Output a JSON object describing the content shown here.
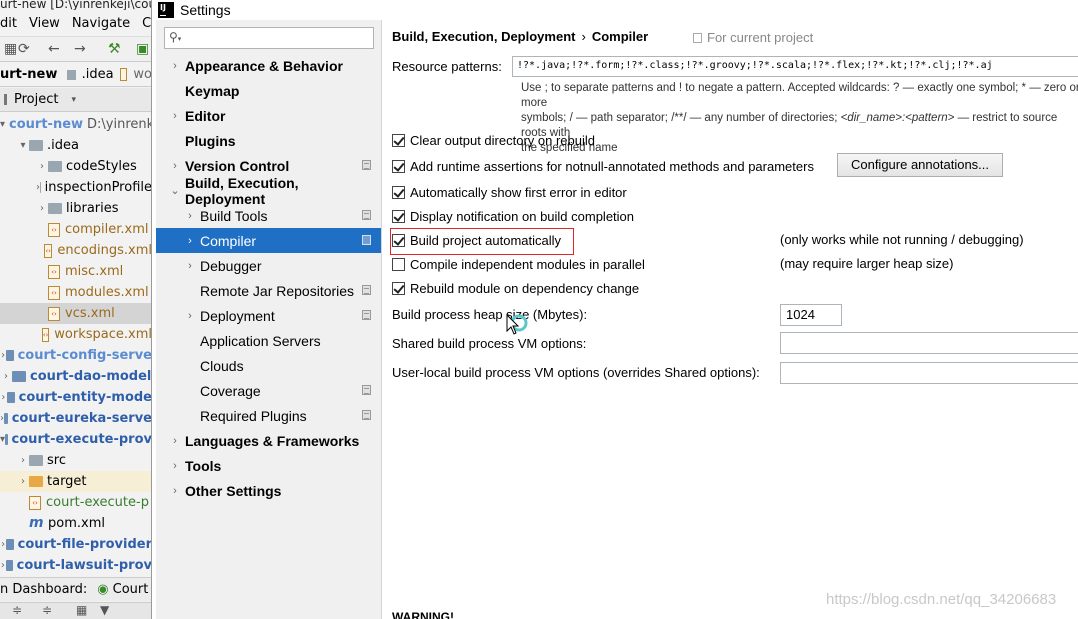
{
  "ide": {
    "title": "urt-new [D:\\yinrenkeji\\cou",
    "menu": [
      "dit",
      "View",
      "Navigate",
      "Co"
    ],
    "nav_bar": {
      "project": "urt-new",
      "folder": ".idea",
      "file": "wo"
    },
    "project_header": "Project",
    "tree": [
      {
        "label": "court-new",
        "extra": "D:\\yinrenke",
        "style": "lightblue",
        "kind": "folder-mod",
        "arrow": "▾",
        "indent": 0
      },
      {
        "label": ".idea",
        "style": "plain",
        "kind": "folder",
        "arrow": "▾",
        "indent": 1
      },
      {
        "label": "codeStyles",
        "style": "plain",
        "kind": "folder",
        "arrow": "›",
        "indent": 2
      },
      {
        "label": "inspectionProfile",
        "style": "plain",
        "kind": "folder",
        "arrow": "›",
        "indent": 2
      },
      {
        "label": "libraries",
        "style": "plain",
        "kind": "folder",
        "arrow": "›",
        "indent": 2
      },
      {
        "label": "compiler.xml",
        "style": "brown",
        "kind": "file",
        "arrow": "",
        "indent": 2
      },
      {
        "label": "encodings.xml",
        "style": "brown",
        "kind": "file",
        "arrow": "",
        "indent": 2
      },
      {
        "label": "misc.xml",
        "style": "brown",
        "kind": "file",
        "arrow": "",
        "indent": 2
      },
      {
        "label": "modules.xml",
        "style": "brown",
        "kind": "file",
        "arrow": "",
        "indent": 2
      },
      {
        "label": "vcs.xml",
        "style": "brown",
        "kind": "file",
        "arrow": "",
        "indent": 2,
        "selected": true
      },
      {
        "label": "workspace.xml",
        "style": "brown",
        "kind": "file",
        "arrow": "",
        "indent": 2
      },
      {
        "label": "court-config-serve",
        "style": "lightblue",
        "kind": "folder-mod",
        "arrow": "›",
        "indent": 0
      },
      {
        "label": "court-dao-model",
        "style": "blue",
        "kind": "folder-mod",
        "arrow": "›",
        "indent": 0
      },
      {
        "label": "court-entity-mode",
        "style": "blue",
        "kind": "folder-mod",
        "arrow": "›",
        "indent": 0
      },
      {
        "label": "court-eureka-serve",
        "style": "blue",
        "kind": "folder-mod",
        "arrow": "›",
        "indent": 0
      },
      {
        "label": "court-execute-prov",
        "style": "blue",
        "kind": "folder-mod",
        "arrow": "▾",
        "indent": 0
      },
      {
        "label": "src",
        "style": "plain",
        "kind": "folder",
        "arrow": "›",
        "indent": 1
      },
      {
        "label": "target",
        "style": "plain",
        "kind": "folder-orange",
        "arrow": "›",
        "indent": 1,
        "highlight": true
      },
      {
        "label": "court-execute-p",
        "style": "green",
        "kind": "file",
        "arrow": "",
        "indent": 1
      },
      {
        "label": "pom.xml",
        "style": "plain",
        "kind": "file-m",
        "arrow": "",
        "indent": 1
      },
      {
        "label": "court-file-provider",
        "style": "blue",
        "kind": "folder-mod",
        "arrow": "›",
        "indent": 0
      },
      {
        "label": "court-lawsuit-prov",
        "style": "blue",
        "kind": "folder-mod",
        "arrow": "›",
        "indent": 0
      }
    ],
    "dashboard": {
      "left": "n Dashboard:",
      "tab": "Court"
    }
  },
  "settings": {
    "window_title": "Settings",
    "app_icon_text": "IJ",
    "search_placeholder": "",
    "nav": [
      {
        "label": "Appearance & Behavior",
        "level": "top",
        "arrow": "›"
      },
      {
        "label": "Keymap",
        "level": "top",
        "arrow": ""
      },
      {
        "label": "Editor",
        "level": "top",
        "arrow": "›"
      },
      {
        "label": "Plugins",
        "level": "top",
        "arrow": ""
      },
      {
        "label": "Version Control",
        "level": "top",
        "arrow": "›",
        "badge": true
      },
      {
        "label": "Build, Execution, Deployment",
        "level": "top",
        "arrow": "⌄"
      },
      {
        "label": "Build Tools",
        "level": "sub",
        "arrow": "›",
        "badge": true
      },
      {
        "label": "Compiler",
        "level": "sub",
        "arrow": "›",
        "badge": true,
        "selected": true
      },
      {
        "label": "Debugger",
        "level": "sub",
        "arrow": "›"
      },
      {
        "label": "Remote Jar Repositories",
        "level": "sub",
        "arrow": "",
        "badge": true
      },
      {
        "label": "Deployment",
        "level": "sub",
        "arrow": "›",
        "badge": true
      },
      {
        "label": "Application Servers",
        "level": "sub",
        "arrow": ""
      },
      {
        "label": "Clouds",
        "level": "sub",
        "arrow": ""
      },
      {
        "label": "Coverage",
        "level": "sub",
        "arrow": "",
        "badge": true
      },
      {
        "label": "Required Plugins",
        "level": "sub",
        "arrow": "",
        "badge": true
      },
      {
        "label": "Languages & Frameworks",
        "level": "top",
        "arrow": "›"
      },
      {
        "label": "Tools",
        "level": "top",
        "arrow": "›"
      },
      {
        "label": "Other Settings",
        "level": "top",
        "arrow": "›"
      }
    ],
    "breadcrumb": {
      "parent": "Build, Execution, Deployment",
      "separator": "›",
      "current": "Compiler"
    },
    "scope_note": "For current project",
    "resource_patterns": {
      "label": "Resource patterns:",
      "value": "!?*.java;!?*.form;!?*.class;!?*.groovy;!?*.scala;!?*.flex;!?*.kt;!?*.clj;!?*.aj",
      "help_line1": "Use ; to separate patterns and ! to negate a pattern. Accepted wildcards: ? — exactly one symbol; * — zero or more",
      "help_line2a": "symbols; / — path separator; /**/ — any number of directories; ",
      "help_line2b": "<dir_name>:<pattern>",
      "help_line2c": " — restrict to source roots with",
      "help_line3": "the specified name"
    },
    "options": [
      {
        "label": "Clear output directory on rebuild",
        "checked": true,
        "note": ""
      },
      {
        "label": "Add runtime assertions for notnull-annotated methods and parameters",
        "checked": true,
        "note": ""
      },
      {
        "label": "Automatically show first error in editor",
        "checked": true,
        "note": ""
      },
      {
        "label": "Display notification on build completion",
        "checked": true,
        "note": ""
      },
      {
        "label": "Build project automatically",
        "checked": true,
        "note": "(only works while not running / debugging)"
      },
      {
        "label": "Compile independent modules in parallel",
        "checked": false,
        "note": "(may require larger heap size)"
      },
      {
        "label": "Rebuild module on dependency change",
        "checked": true,
        "note": ""
      }
    ],
    "configure_annotations": "Configure annotations...",
    "heap": {
      "label": "Build process heap size (Mbytes):",
      "value": "1024"
    },
    "shared_vm": {
      "label": "Shared build process VM options:",
      "value": ""
    },
    "user_vm": {
      "label": "User-local build process VM options (overrides Shared options):",
      "value": ""
    },
    "warning": "WARNING!",
    "watermark": "https://blog.csdn.net/qq_34206683"
  }
}
